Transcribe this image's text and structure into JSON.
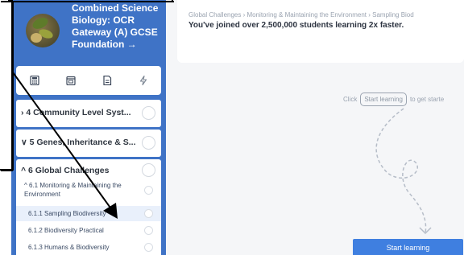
{
  "course": {
    "title": "Combined Science Biology: OCR Gateway (A) GCSE Foundation →",
    "icon": "biology-course-avatar"
  },
  "tabs": [
    {
      "icon": "calculator-icon"
    },
    {
      "icon": "calendar-icon"
    },
    {
      "icon": "document-icon"
    },
    {
      "icon": "lightning-icon"
    }
  ],
  "units": [
    {
      "label": "› 4 Community Level Syst..."
    },
    {
      "label": "∨ 5 Genes, Inheritance & S..."
    },
    {
      "label": "^ 6 Global Challenges"
    }
  ],
  "subtopic": {
    "label": "^ 6.1 Monitoring & Maintaining the Environment"
  },
  "lessons": [
    {
      "label": "6.1.1 Sampling Biodiversity"
    },
    {
      "label": "6.1.2 Biodiversity Practical"
    },
    {
      "label": "6.1.3 Humans & Biodiversity"
    }
  ],
  "main": {
    "breadcrumb": "Global Challenges › Monitoring & Maintaining the Environment › Sampling Biod",
    "joined_text": "You've joined over 2,500,000 students learning 2x faster.",
    "prompt_before": "Click",
    "prompt_pill": "Start learning",
    "prompt_after": "to get starte",
    "start_button": "Start learning"
  },
  "colors": {
    "sidebar": "#3f73c6",
    "accent": "#3f7fe0",
    "active_row": "#e9f0fb"
  }
}
